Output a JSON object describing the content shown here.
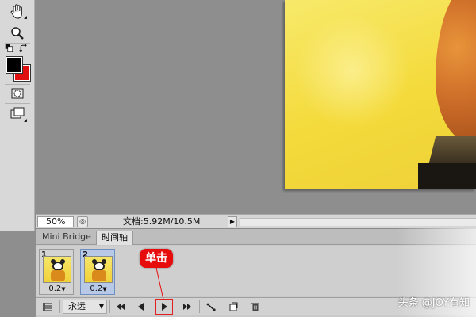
{
  "status_bar": {
    "zoom": "50%",
    "doc_info": "文档:5.92M/10.5M"
  },
  "timeline_panel": {
    "tabs": [
      {
        "label": "Mini Bridge",
        "active": false
      },
      {
        "label": "时间轴",
        "active": true
      }
    ],
    "frames": [
      {
        "number": "1",
        "delay": "0.2",
        "selected": false
      },
      {
        "number": "2",
        "delay": "0.2",
        "selected": true
      }
    ],
    "loop_option": "永远"
  },
  "annotation": {
    "label": "单击",
    "color": "#e80d0d"
  },
  "watermark": "头条 @JOY有知",
  "tools": {
    "foreground_color": "#000000",
    "background_color": "#e01010"
  },
  "icons": [
    "hand-icon",
    "zoom-icon",
    "default-colors-icon",
    "swap-colors-icon",
    "quick-mask-icon",
    "screen-mode-icon",
    "select-first-frame-icon",
    "previous-frame-icon",
    "play-icon",
    "next-frame-icon",
    "tween-icon",
    "duplicate-frame-icon",
    "delete-frame-icon",
    "panel-menu-icon"
  ]
}
